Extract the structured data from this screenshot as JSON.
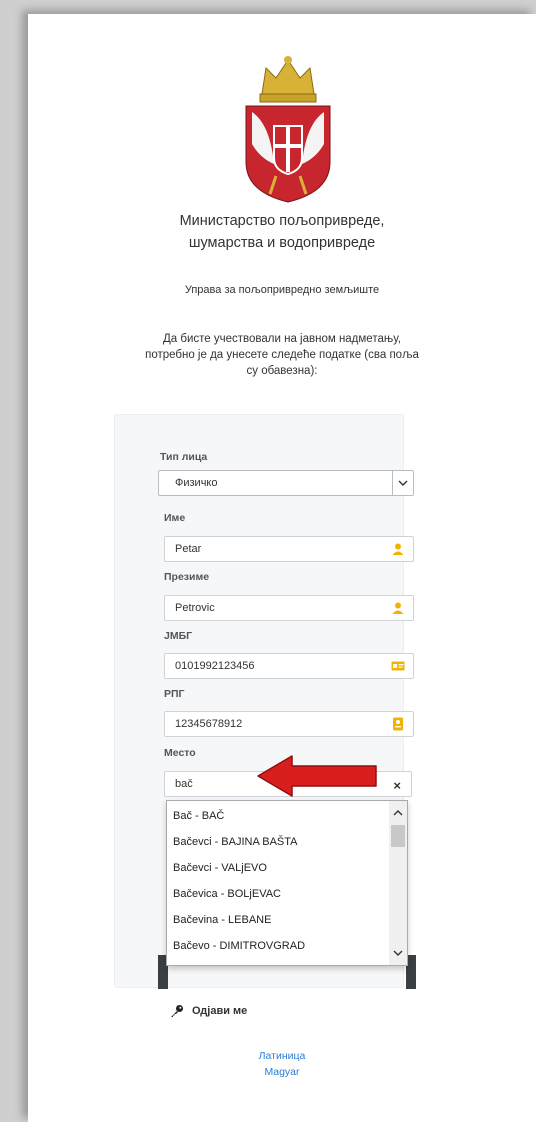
{
  "header": {
    "ministry_line1": "Министарство пољопривреде,",
    "ministry_line2": "шумарства и водопривреде",
    "department": "Управа за пољопривредно земљиште",
    "intro_line1": "Да бисте учествовали на јавном надметању,",
    "intro_line2": "потребно је да унесете следеће податке (сва поља",
    "intro_line3": "су обавезна):"
  },
  "form": {
    "person_type_label": "Тип лица",
    "person_type_value": "Физичко",
    "name_label": "Име",
    "name_value": "Petar",
    "surname_label": "Презиме",
    "surname_value": "Petrovic",
    "jmbg_label": "ЈМБГ",
    "jmbg_value": "0101992123456",
    "rpg_label": "РПГ",
    "rpg_value": "12345678912",
    "place_label": "Место",
    "place_value": "bač",
    "clear_symbol": "×",
    "logout_label": "Одјави ме"
  },
  "dropdown": {
    "options": [
      "Bač - BAČ",
      "Bačevci - BAJINA BAŠTA",
      "Bačevci - VALjEVO",
      "Bačevica - BOLjEVAC",
      "Bačevina - LEBANE",
      "Bačevo - DIMITROVGRAD"
    ]
  },
  "footer": {
    "latin_link": "Латиница",
    "hungarian_link": "Magyar"
  },
  "colors": {
    "accent_icon": "#f0b400",
    "link": "#2b7bd4",
    "annotation_arrow": "#d81e1e"
  },
  "icons": [
    "coat-of-arms-logo",
    "user-icon",
    "id-card-icon",
    "badge-icon",
    "key-icon",
    "chevron-down-icon",
    "red-arrow-annotation"
  ]
}
